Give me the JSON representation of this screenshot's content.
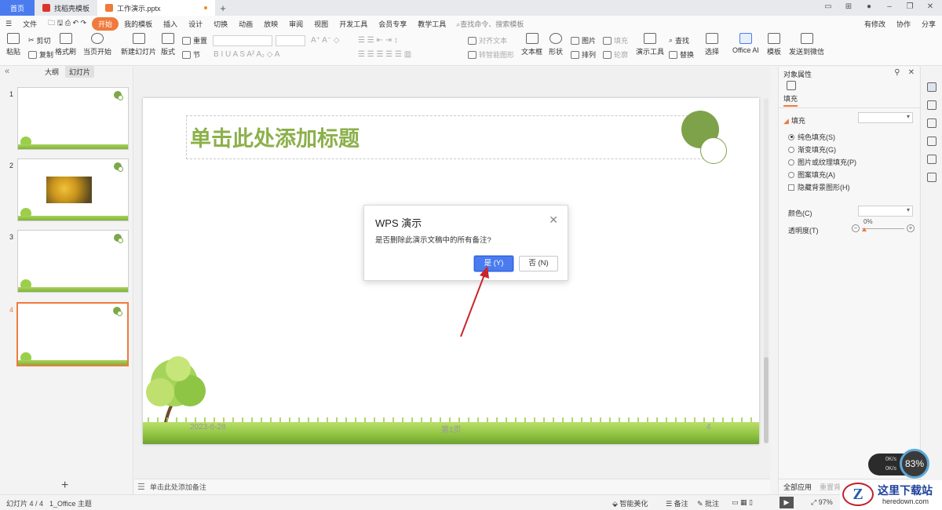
{
  "tabs": {
    "home": "首页",
    "template": "找稻壳模板",
    "file": "工作演示.pptx",
    "add": "+"
  },
  "menu": {
    "file": "文件",
    "items": [
      "开始",
      "我的模板",
      "插入",
      "设计",
      "切换",
      "动画",
      "放映",
      "审阅",
      "视图",
      "开发工具",
      "会员专享",
      "教学工具"
    ],
    "active": "开始",
    "search_placeholder": "查找命令、搜索模板",
    "right": [
      "有修改",
      "协作",
      "分享"
    ]
  },
  "ribbon": {
    "paste": "粘贴",
    "cut": "剪切",
    "copy": "复制",
    "format_painter": "格式刷",
    "from_current": "当页开始",
    "new_slide": "新建幻灯片",
    "layout": "版式",
    "reset": "重置",
    "section": "节",
    "align_text": "对齐文本",
    "smart_art": "转智能图形",
    "textbox": "文本框",
    "shape": "形状",
    "picture": "图片",
    "fill": "填充",
    "arrange": "排列",
    "outline": "轮廓",
    "present_tools": "演示工具",
    "find": "查找",
    "replace": "替换",
    "select": "选择",
    "office_ai": "Office AI",
    "template": "模板",
    "send_wechat": "发送到微信"
  },
  "left_pane": {
    "tab_outline": "大纲",
    "tab_slides": "幻灯片",
    "slides": [
      {
        "num": "1",
        "has_photo": false,
        "selected": false
      },
      {
        "num": "2",
        "has_photo": true,
        "selected": false
      },
      {
        "num": "3",
        "has_photo": false,
        "selected": false
      },
      {
        "num": "4",
        "has_photo": false,
        "selected": true
      }
    ],
    "add": "+"
  },
  "slide": {
    "title": "单击此处添加标题",
    "date": "2023-6-28",
    "page": "第1页",
    "num": "4"
  },
  "notes": {
    "placeholder": "单击此处添加备注"
  },
  "dialog": {
    "title": "WPS 演示",
    "message": "是否删除此演示文稿中的所有备注?",
    "yes": "是 (Y)",
    "no": "否 (N)"
  },
  "right_pane": {
    "header": "对象属性",
    "tab": "填充",
    "section": "填充",
    "options": [
      {
        "label": "纯色填充(S)",
        "type": "radio",
        "checked": true
      },
      {
        "label": "渐变填充(G)",
        "type": "radio",
        "checked": false
      },
      {
        "label": "图片或纹理填充(P)",
        "type": "radio",
        "checked": false
      },
      {
        "label": "图案填充(A)",
        "type": "radio",
        "checked": false
      },
      {
        "label": "隐藏背景图形(H)",
        "type": "checkbox",
        "checked": false
      }
    ],
    "color_label": "颜色(C)",
    "transparency_label": "透明度(T)",
    "transparency_value": "0%",
    "apply_all": "全部应用",
    "reset_bg": "重置背景"
  },
  "status": {
    "slide_info": "幻灯片 4 / 4",
    "theme": "1_Office 主题",
    "smart_beautify": "智能美化",
    "notes": "备注",
    "comments": "批注",
    "zoom": "97%"
  },
  "speed": {
    "up": "0K/s",
    "down": "0K/s",
    "percent": "83%"
  },
  "watermark": {
    "name": "这里下载站",
    "url": "heredown.com"
  },
  "colors": {
    "accent": "#f07a3c",
    "primary_blue": "#4a7cf0",
    "title_green": "#8cb04a"
  }
}
